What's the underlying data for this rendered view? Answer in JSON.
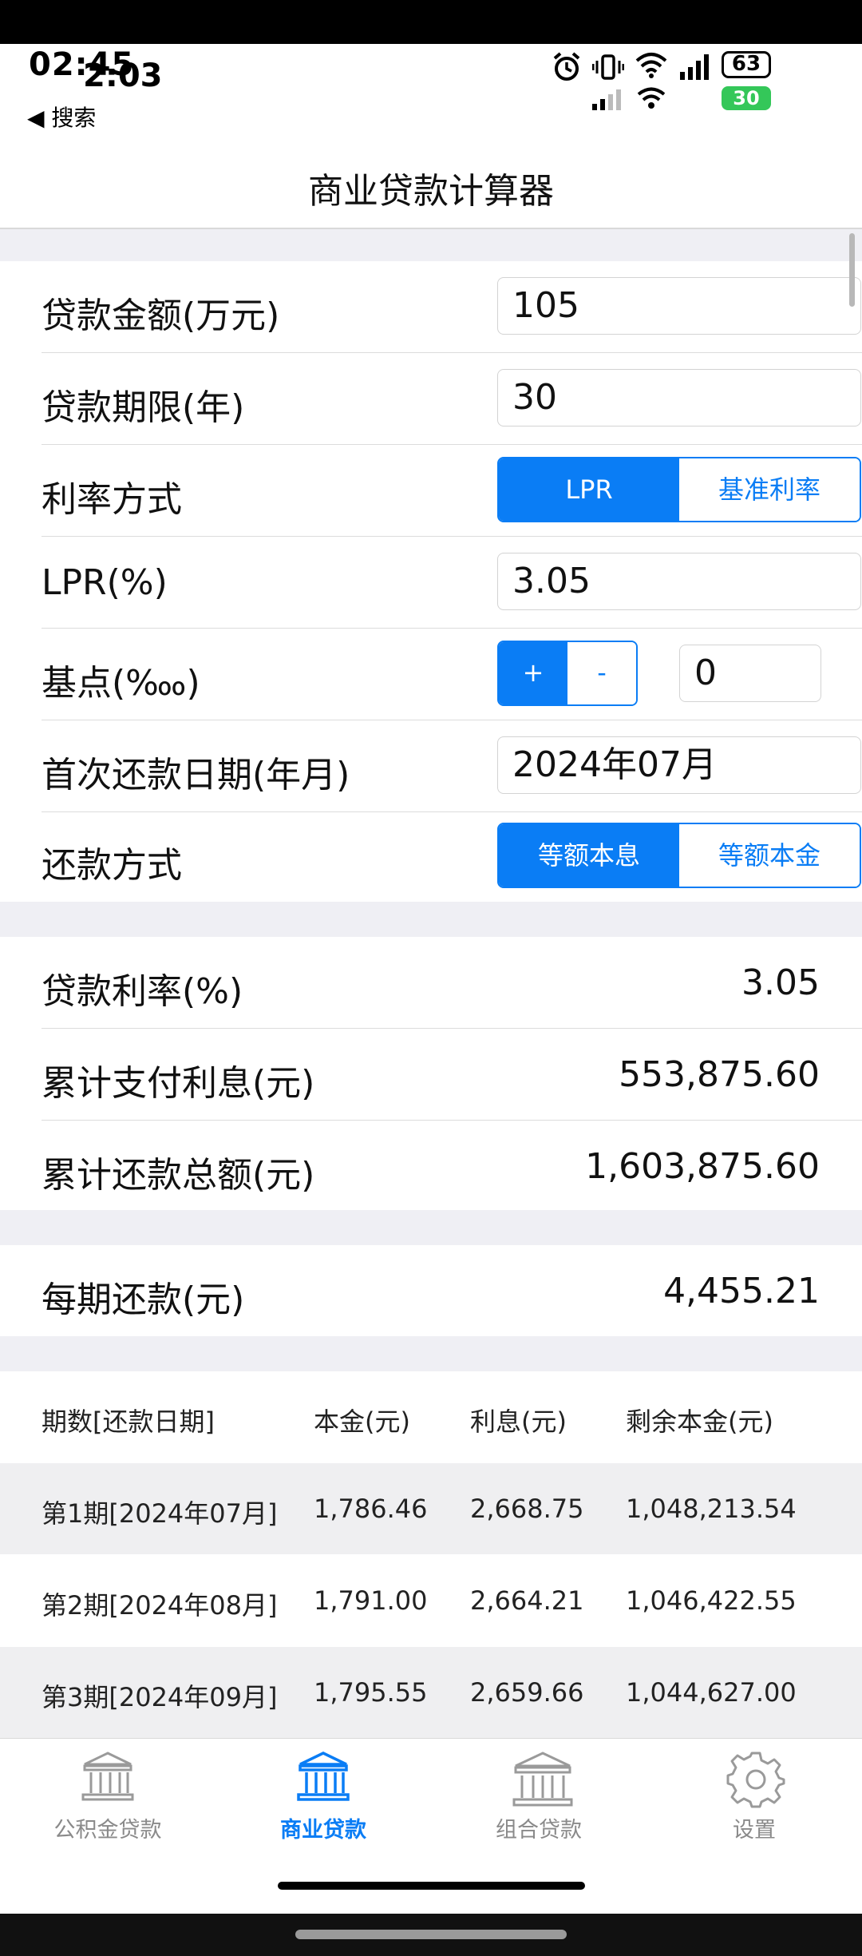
{
  "status_bar": {
    "time_primary": "02:45",
    "time_secondary": "2:03",
    "back_label": "◀ 搜索",
    "battery_top": "63",
    "battery_bottom": "30"
  },
  "nav": {
    "title": "商业贷款计算器"
  },
  "inputs": {
    "loan_amount": {
      "label": "贷款金额(万元)",
      "value": "105"
    },
    "loan_term": {
      "label": "贷款期限(年)",
      "value": "30"
    },
    "rate_method": {
      "label": "利率方式",
      "options": [
        "LPR",
        "基准利率"
      ],
      "selected": "LPR"
    },
    "lpr": {
      "label": "LPR(%)",
      "value": "3.05"
    },
    "basis_points": {
      "label": "基点(‱)",
      "plus": "+",
      "minus": "-",
      "value": "0"
    },
    "first_payment_date": {
      "label": "首次还款日期(年月)",
      "value": "2024年07月"
    },
    "repayment_method": {
      "label": "还款方式",
      "options": [
        "等额本息",
        "等额本金"
      ],
      "selected": "等额本息"
    }
  },
  "results": {
    "loan_rate": {
      "label": "贷款利率(%)",
      "value": "3.05"
    },
    "total_interest": {
      "label": "累计支付利息(元)",
      "value": "553,875.60"
    },
    "total_repayment": {
      "label": "累计还款总额(元)",
      "value": "1,603,875.60"
    }
  },
  "monthly": {
    "label": "每期还款(元)",
    "value": "4,455.21"
  },
  "schedule": {
    "headers": [
      "期数[还款日期]",
      "本金(元)",
      "利息(元)",
      "剩余本金(元)"
    ],
    "rows": [
      [
        "第1期[2024年07月]",
        "1,786.46",
        "2,668.75",
        "1,048,213.54"
      ],
      [
        "第2期[2024年08月]",
        "1,791.00",
        "2,664.21",
        "1,046,422.55"
      ],
      [
        "第3期[2024年09月]",
        "1,795.55",
        "2,659.66",
        "1,044,627.00"
      ]
    ]
  },
  "tabbar": {
    "tabs": [
      {
        "label": "公积金贷款",
        "icon": "bank-icon"
      },
      {
        "label": "商业贷款",
        "icon": "bank-icon"
      },
      {
        "label": "组合贷款",
        "icon": "bank-icon"
      },
      {
        "label": "设置",
        "icon": "gear-icon"
      }
    ],
    "active": "商业贷款"
  },
  "colors": {
    "accent": "#0a7df5",
    "group_bg": "#efeff4",
    "alt_row": "#efeff1"
  }
}
